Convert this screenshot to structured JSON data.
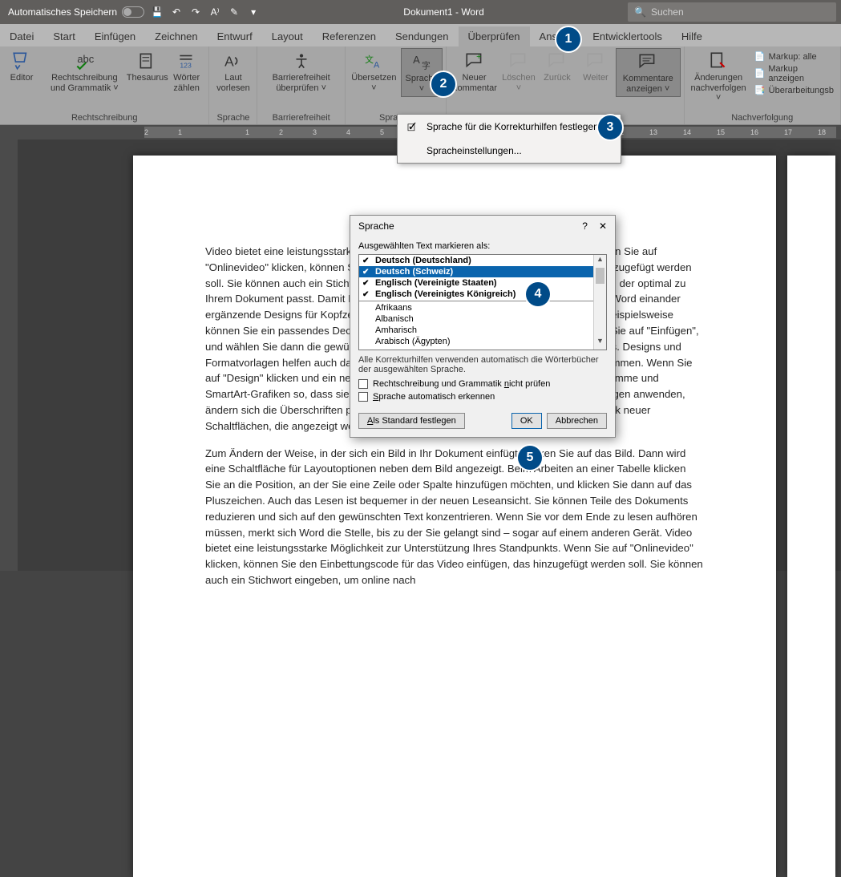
{
  "titlebar": {
    "autosave": "Automatisches Speichern",
    "title": "Dokument1 - Word",
    "search_placeholder": "Suchen"
  },
  "tabs": [
    "Datei",
    "Start",
    "Einfügen",
    "Zeichnen",
    "Entwurf",
    "Layout",
    "Referenzen",
    "Sendungen",
    "Überprüfen",
    "Ansicht",
    "Entwicklertools",
    "Hilfe"
  ],
  "active_tab": 8,
  "ribbon": {
    "groups": [
      {
        "label": "Rechtschreibung",
        "buttons": [
          "Editor",
          "Rechtschreibung und Grammatik ˅",
          "Thesaurus",
          "Wörter zählen"
        ]
      },
      {
        "label": "Sprache",
        "buttons": [
          "Laut vorlesen"
        ]
      },
      {
        "label": "Barrierefreiheit",
        "buttons": [
          "Barrierefreiheit überprüfen ˅"
        ]
      },
      {
        "label": "Sprache",
        "buttons": [
          "Übersetzen ˅",
          "Sprache ˅"
        ]
      },
      {
        "label": "",
        "buttons": [
          "Neuer Kommentar",
          "Löschen ˅",
          "Zurück",
          "Weiter",
          "Kommentare anzeigen ˅"
        ]
      },
      {
        "label": "Nachverfolgung",
        "buttons": [
          "Änderungen nachverfolgen ˅"
        ],
        "side": [
          "Markup: alle",
          "Markup anzeigen",
          "Überarbeitungsb"
        ]
      }
    ]
  },
  "dropdown": {
    "items": [
      "Sprache für die Korrekturhilfen festlegen...",
      "Spracheinstellungen..."
    ]
  },
  "dialog": {
    "title": "Sprache",
    "label": "Ausgewählten Text markieren als:",
    "items": [
      {
        "text": "Deutsch (Deutschland)",
        "bold": true,
        "check": true
      },
      {
        "text": "Deutsch (Schweiz)",
        "bold": true,
        "selected": true,
        "check": true
      },
      {
        "text": "Englisch (Vereinigte Staaten)",
        "bold": true,
        "check": true
      },
      {
        "text": "Englisch (Vereinigtes Königreich)",
        "bold": true,
        "check": true
      },
      {
        "text": "Afrikaans"
      },
      {
        "text": "Albanisch"
      },
      {
        "text": "Amharisch"
      },
      {
        "text": "Arabisch (Ägypten)"
      }
    ],
    "note": "Alle Korrekturhilfen verwenden automatisch die Wörterbücher der ausgewählten Sprache.",
    "cb1": "Rechtschreibung und Grammatik nicht prüfen",
    "cb2": "Sprache automatisch erkennen",
    "btn_default": "Als Standard festlegen",
    "btn_ok": "OK",
    "btn_cancel": "Abbrechen"
  },
  "doc": {
    "p1": "Video bietet eine leistungsstarke Möglichkeit zur Unterstützung Ihres Standpunkts. Wenn Sie auf \"Onlinevideo\" klicken, können Sie den Einbettungscode für das Video einfügen, das hinzugefügt werden soll. Sie können auch ein Stichwort eingeben, um online nach dem Videoclip zu suchen, der optimal zu Ihrem Dokument passt. Damit Ihr Dokument ein professionelles Aussehen erhält, stellt Word einander ergänzende Designs für Kopfzeile, Fußzeile, Deckblatt und Textfelder zur Verfügung. Beispielsweise können Sie ein passendes Deckblatt mit Kopfzeile und Randleiste hinzufügen. Klicken Sie auf \"Einfügen\", und wählen Sie dann die gewünschten Elemente aus den verschiedenen Katalogen aus. Designs und Formatvorlagen helfen auch dabei, die Elemente Ihres Dokuments aufeinander abzustimmen. Wenn Sie auf \"Design\" klicken und ein neues Design auswählen, ändern sich die Grafiken, Diagramme und SmartArt-Grafiken so, dass sie dem neuen Design entsprechen. Wenn Sie Formatvorlagen anwenden, ändern sich die Überschriften passend zum neuen Design. Sparen Sie Zeit in Word dank neuer Schaltflächen, die angezeigt werden, wo Sie sie benötigen.",
    "p2": "Zum Ändern der Weise, in der sich ein Bild in Ihr Dokument einfügt, klicken Sie auf das Bild. Dann wird eine Schaltfläche für Layoutoptionen neben dem Bild angezeigt. Beim Arbeiten an einer Tabelle klicken Sie an die Position, an der Sie eine Zeile oder Spalte hinzufügen möchten, und klicken Sie dann auf das Pluszeichen. Auch das Lesen ist bequemer in der neuen Leseansicht. Sie können Teile des Dokuments reduzieren und sich auf den gewünschten Text konzentrieren. Wenn Sie vor dem Ende zu lesen aufhören müssen, merkt sich Word die Stelle, bis zu der Sie gelangt sind – sogar auf einem anderen Gerät. Video bietet eine leistungsstarke Möglichkeit zur Unterstützung Ihres Standpunkts. Wenn Sie auf \"Onlinevideo\" klicken, können Sie den Einbettungscode für das Video einfügen, das hinzugefügt werden soll. Sie können auch ein Stichwort eingeben, um online nach"
  },
  "ruler_ticks": [
    "2",
    "1",
    "",
    "1",
    "2",
    "3",
    "4",
    "5",
    "6",
    "7",
    "8",
    "9",
    "10",
    "11",
    "12",
    "13",
    "14",
    "15",
    "16",
    "17",
    "18"
  ]
}
